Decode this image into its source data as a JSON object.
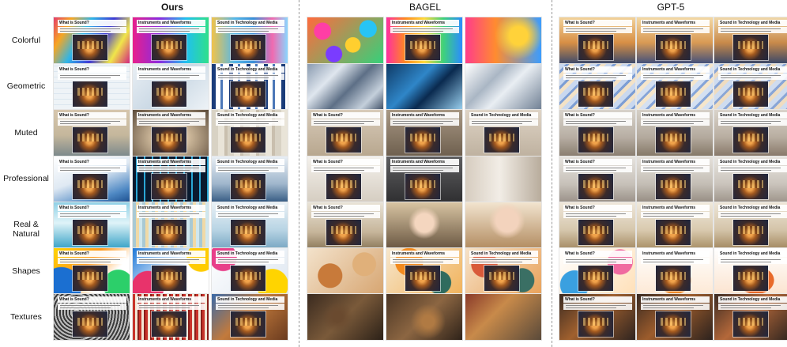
{
  "columns": [
    "Ours",
    "BAGEL",
    "GPT-5"
  ],
  "rows": [
    "Colorful",
    "Geometric",
    "Muted",
    "Professional",
    "Real & Natural",
    "Shapes",
    "Textures"
  ],
  "slide_titles": [
    "What is Sound?",
    "Instruments and Waveforms",
    "Sound in Technology and Media"
  ],
  "backgrounds": {
    "ours": [
      [
        "linear-gradient(120deg,#e43d6b 0%,#f6a623 18%,#2fb5e8 38%,#3f3ad6 60%,#f0e64a 80%,#d2267f 100%)",
        "linear-gradient(90deg,#e81f8c 0%,#8b2be0 35%,#20c0f0 70%,#2fe08a 100%)",
        "linear-gradient(90deg,#f1c34a 0%,#56b8e8 30%,#3a8fd8 55%,#f06ab0 80%,#8ad6ff 100%)"
      ],
      [
        "repeating-linear-gradient(0deg,#eef3f7 0 6px,#dbe6ef 6px 7px),repeating-linear-gradient(90deg,transparent 0 6px,#dbe6ef 6px 7px)",
        "linear-gradient(135deg,#e9eff4 0%,#cbd9e5 50%,#eef3f7 100%)",
        "repeating-linear-gradient(90deg,#1a3c7a 0 5px,#ffffff 5px 11px,#4c78b8 11px 14px,#ffffff 14px 22px)"
      ],
      [
        "linear-gradient(180deg,#d6c6ad 0%,#c5b79c 55%,#7d8a8c 100%)",
        "radial-gradient(ellipse at 50% 60%,#fff6dc 0%,#cdb89a 35%,#5b4a3a 100%)",
        "repeating-linear-gradient(90deg,#d8d2c4 0 8px,#e9e4d8 8px 16px,#c9bfae 16px 20px)"
      ],
      [
        "linear-gradient(160deg,#ffffff 0%,#dfe9f3 45%,#4f89c4 80%,#1c4f8f 100%)",
        "repeating-linear-gradient(90deg,#0a1a2f 0 4px,#2aa7d6 4px 6px,#0a1a2f 6px 10px)",
        "linear-gradient(180deg,#e8eef4 0%,#9fb6cc 60%,#355a82 100%)"
      ],
      [
        "linear-gradient(180deg,#8fd0e6 0%,#dff3f8 45%,#3aa3c7 100%)",
        "repeating-linear-gradient(90deg,#a8c9d4 0 4px,#f0d9a6 4px 8px,#cfe7ee 8px 12px)",
        "linear-gradient(180deg,#e9f1f6 0%,#b8d4e4 60%,#7aa8c4 100%)"
      ],
      [
        "radial-gradient(circle at 85% 80%,#2ccf6a 0 20%,transparent 21%),radial-gradient(circle at 10% 85%,#1b6fd1 0 25%,transparent 26%),linear-gradient(135deg,#ffd400 0%,#ff9a1f 40%,#ffffff 70%)",
        "radial-gradient(circle at 20% 85%,#e8336b 0 22%,transparent 23%),radial-gradient(circle at 90% 20%,#ffcc00 0 18%,transparent 19%),linear-gradient(135deg,#1e78d8 0%,#ffffff 60%)",
        "radial-gradient(circle at 80% 80%,#ffd400 0 22%,transparent 23%),radial-gradient(circle at 15% 20%,#e83f8a 0 18%,transparent 19%),linear-gradient(135deg,#ffffff 0%,#dde6f0 100%)"
      ],
      [
        "repeating-radial-gradient(circle at 30% 40%,#3a3a3a 0 2px,#bdbdbd 2px 4px)",
        "repeating-linear-gradient(90deg,#c8332a 0 3px,#f2e7d5 3px 6px,#8a1f1a 6px 8px)",
        "linear-gradient(135deg,#3a6aa8 0%,#c27a3c 45%,#6a3b1f 100%)"
      ]
    ],
    "bagel": [
      [
        "radial-gradient(circle at 20% 30%,#ff3ea5 0 12%,transparent 13%),radial-gradient(circle at 60% 60%,#ffcf2f 0 14%,transparent 15%),radial-gradient(circle at 80% 25%,#27c4f5 0 12%,transparent 13%),radial-gradient(circle at 35% 80%,#7a3cff 0 13%,transparent 14%),linear-gradient(135deg,#ff6b3d,#36d07a)",
        "linear-gradient(90deg,#ff2fa0 0%,#ff8a1f 25%,#ffd93b 50%,#3fd27a 75%,#2a8cff 100%)",
        "radial-gradient(circle at 70% 40%,#ffd23a 0 15%,transparent 40%),linear-gradient(90deg,#ff3d8b 0%,#ff8c2f 40%,#3a9cff 100%)"
      ],
      [
        "linear-gradient(135deg,#8a9bb0 0%,#dfe6ee 30%,#5d6f86 55%,#c4cfdb 80%,#3e4f66 100%)",
        "linear-gradient(135deg,#0f3a66 0%,#2f86c8 40%,#0a2a4f 60%,#9ad0ef 100%)",
        "linear-gradient(135deg,#ffffff 0%,#aab6c4 35%,#e9eef3 55%,#6f7f93 100%)"
      ],
      [
        "linear-gradient(180deg,#d8cbb9 0%,#b8a78f 100%)",
        "linear-gradient(180deg,#a89884 0%,#6f604f 100%)",
        "linear-gradient(180deg,#dfd4c6 0%,#bfb2a0 100%)"
      ],
      [
        "linear-gradient(180deg,#f4f1ec 0%,#d5cdc1 100%)",
        "linear-gradient(180deg,#5e5e60 0%,#2f2f31 100%)",
        "linear-gradient(90deg,#d6ccbf 0%,#f2ede6 45%,#b8ac9c 100%)"
      ],
      [
        "linear-gradient(180deg,#e9e3d6 0%,#c6b59a 65%,#8f7c5e 100%)",
        "radial-gradient(circle at 50% 45%,#f4d6bf 0 20%,transparent 35%),linear-gradient(180deg,#d8c4a2 0%,#6b5843 100%)",
        "radial-gradient(circle at 55% 40%,#f3d3bd 0 22%,transparent 36%),linear-gradient(180deg,#f2e4cf 0%,#b38d62 100%)"
      ],
      [
        "radial-gradient(circle at 30% 60%,#c87a3a 0 20%,transparent 21%),radial-gradient(circle at 75% 35%,#e0b07a 0 18%,transparent 19%),linear-gradient(135deg,#f3e2cb,#d7a672)",
        "radial-gradient(circle at 70% 75%,#2f6b5e 0 18%,transparent 19%),radial-gradient(circle at 30% 30%,#f28a1e 0 22%,transparent 23%),linear-gradient(135deg,#f6e6cc,#f1b35c)",
        "radial-gradient(circle at 75% 70%,#3a6f64 0 18%,transparent 19%),radial-gradient(circle at 25% 35%,#d95a3a 0 20%,transparent 21%),linear-gradient(135deg,#f6e2c8,#e9a25a)"
      ],
      [
        "radial-gradient(circle at 40% 50%,#6a4a2f 0 10%,transparent 30%),linear-gradient(135deg,#3a2a1f 0%,#7a5a3a 50%,#2c2118 100%)",
        "radial-gradient(circle at 55% 60%,#b07a43 0 12%,transparent 35%),linear-gradient(135deg,#4a3524 0%,#8c6642 50%,#2e2219 100%)",
        "linear-gradient(135deg,#8a3a2a 0%,#c88a4a 40%,#5a4a3a 100%)"
      ]
    ],
    "gpt": [
      [
        "linear-gradient(180deg,#f2d29a 0%,#d88f45 55%,#3f4b6a 100%)",
        "linear-gradient(180deg,#f3d9a5 0%,#d99a54 55%,#45517a 100%)",
        "linear-gradient(180deg,#f0d7a8 0%,#c98a4a 55%,#3c4867 100%)"
      ],
      [
        "repeating-linear-gradient(135deg,#c9d8ef 0 6px,#7d9ed4 6px 9px,#f3e2c6 9px 14px)",
        "repeating-linear-gradient(135deg,#d4e0f1 0 6px,#86a5d8 6px 9px,#f5e6cb 9px 14px)",
        "repeating-linear-gradient(135deg,#cfdcef 0 6px,#8aa6d6 6px 9px,#efdcc0 9px 14px)"
      ],
      [
        "linear-gradient(180deg,#d8d3cb 0%,#b7aea3 60%,#8a7e70 100%)",
        "linear-gradient(180deg,#d6d0c7 0%,#b3a99d 60%,#857968 100%)",
        "linear-gradient(180deg,#dad4cb 0%,#b8ada0 60%,#88796a 100%)"
      ],
      [
        "linear-gradient(180deg,#e7e4df 0%,#c7c1b9 60%,#9a9188 100%)",
        "linear-gradient(180deg,#e6e2dc 0%,#c4beb5 60%,#968d83 100%)",
        "linear-gradient(180deg,#e9e6e1 0%,#cac4bc 60%,#9d948a 100%)"
      ],
      [
        "linear-gradient(180deg,#efe7da 0%,#d6c7ad 60%,#a78d66 100%)",
        "linear-gradient(180deg,#f0e9dc 0%,#d9caaf 60%,#aa9168 100%)",
        "linear-gradient(180deg,#eee6d8 0%,#d4c4a9 60%,#a48a62 100%)"
      ],
      [
        "radial-gradient(circle at 80% 30%,#f06aa0 0 18%,transparent 19%),radial-gradient(circle at 20% 80%,#3aa0e0 0 20%,transparent 21%),linear-gradient(135deg,#ffffff,#ffe0b8)",
        "radial-gradient(ellipse at 50% 70%,#f08a2a 0 30%,transparent 31%),linear-gradient(180deg,#ffffff 0%,#fde9d6 100%)",
        "radial-gradient(ellipse at 55% 70%,#e86a2a 0 30%,transparent 31%),linear-gradient(180deg,#ffffff 0%,#fbe4d0 100%)"
      ],
      [
        "linear-gradient(135deg,#3a2a22 0%,#a0602e 45%,#2f2420 100%)",
        "linear-gradient(135deg,#382922 0%,#9c5c2c 45%,#2c221e 100%)",
        "linear-gradient(135deg,#3b2b23 0%,#b4683a 45%,#30251f 100%)"
      ]
    ]
  }
}
